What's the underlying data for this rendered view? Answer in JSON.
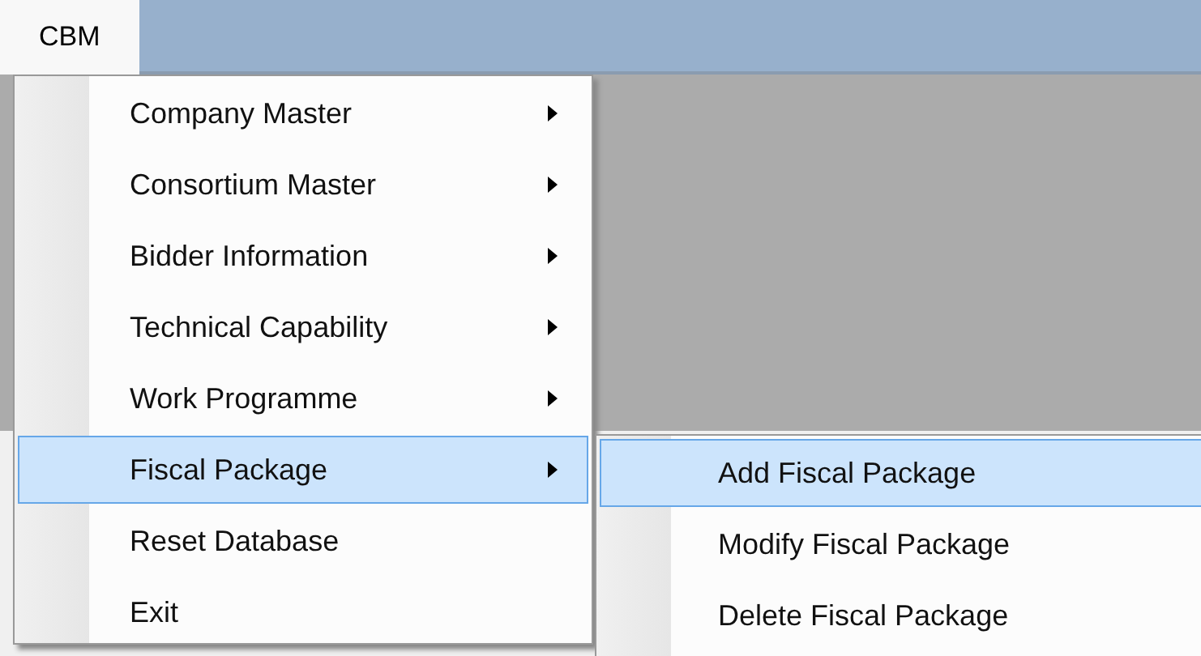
{
  "menu_bar": [
    {
      "label": "CBM",
      "selected": true
    }
  ],
  "menu": {
    "items": [
      {
        "label": "Company Master",
        "has_submenu": true,
        "selected": false
      },
      {
        "label": "Consortium Master",
        "has_submenu": true,
        "selected": false
      },
      {
        "label": "Bidder Information",
        "has_submenu": true,
        "selected": false
      },
      {
        "label": "Technical Capability",
        "has_submenu": true,
        "selected": false
      },
      {
        "label": "Work Programme",
        "has_submenu": true,
        "selected": false
      },
      {
        "label": "Fiscal Package",
        "has_submenu": true,
        "selected": true
      },
      {
        "label": "Reset Database",
        "has_submenu": false,
        "selected": false
      },
      {
        "label": "Exit",
        "has_submenu": false,
        "selected": false
      }
    ]
  },
  "submenu": {
    "items": [
      {
        "label": "Add Fiscal Package",
        "selected": true
      },
      {
        "label": "Modify Fiscal Package",
        "selected": false
      },
      {
        "label": "Delete Fiscal Package",
        "selected": false
      }
    ]
  }
}
